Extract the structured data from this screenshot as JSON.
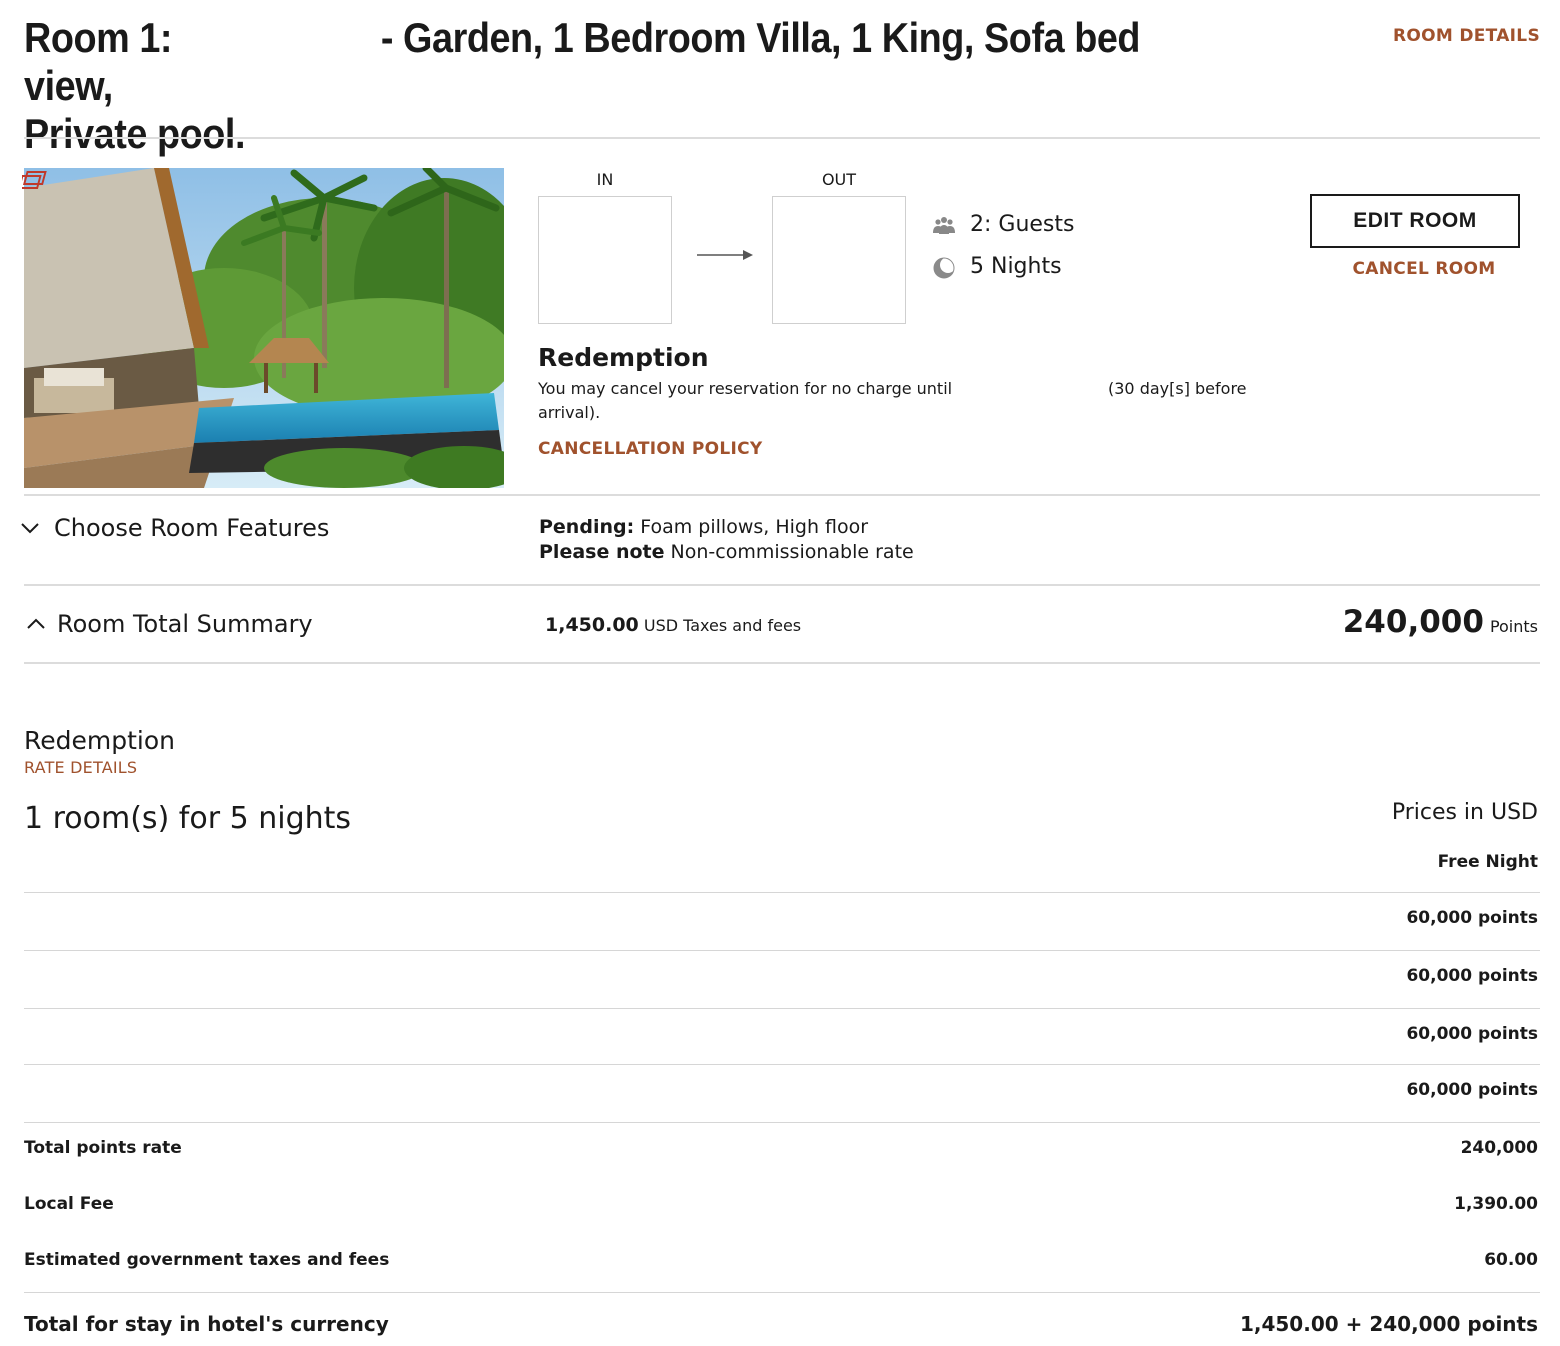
{
  "header": {
    "room_number": "Room  1:",
    "room_name": "- Garden, 1 Bedroom Villa, 1 King, Sofa bed view,",
    "room_name_cont": "Private pool.",
    "room_details_link": "ROOM DETAILS"
  },
  "dates": {
    "in_label": "IN",
    "out_label": "OUT"
  },
  "stay_info": {
    "guests": "2: Guests",
    "nights": "5 Nights"
  },
  "actions": {
    "edit_room": "EDIT ROOM",
    "cancel_room": "CANCEL ROOM"
  },
  "rate": {
    "name": "Redemption",
    "cancel_text": "You may cancel your reservation for no charge until",
    "cancel_deadline": "(30 day[s] before",
    "cancel_text_cont": "arrival).",
    "cancellation_policy_link": "CANCELLATION POLICY"
  },
  "features": {
    "toggle_label": "Choose Room Features",
    "pending_label": "Pending:",
    "pending_value": " Foam pillows,  High floor",
    "note_label": "Please note",
    "note_value": " Non-commissionable rate"
  },
  "summary": {
    "toggle_label": "Room Total Summary",
    "taxes_amount": "1,450.00",
    "taxes_label": " USD Taxes and fees",
    "points_amount": "240,000",
    "points_label": "Points"
  },
  "rate_details": {
    "title": "Redemption",
    "link": "RATE DETAILS",
    "stay_heading": "1 room(s) for 5 nights",
    "prices_in": "Prices in USD",
    "free_night": "Free Night",
    "nights": [
      "60,000 points",
      "60,000 points",
      "60,000 points",
      "60,000 points"
    ],
    "total_points_label": "Total points rate",
    "total_points_value": "240,000",
    "local_fee_label": "Local Fee",
    "local_fee_value": "1,390.00",
    "gov_tax_label": "Estimated government taxes and fees",
    "gov_tax_value": "60.00",
    "grand_total_label": "Total for stay in hotel's currency",
    "grand_total_value": "1,450.00 + 240,000 points"
  },
  "colors": {
    "accent": "#a0522d",
    "text": "#1a1a1a",
    "divider": "#dcdcdc"
  },
  "icons": {
    "guests": "guests-icon",
    "nights": "moon-icon",
    "arrow": "arrow-right-icon",
    "features_toggle": "chevron-down-icon",
    "summary_toggle": "chevron-up-icon"
  }
}
